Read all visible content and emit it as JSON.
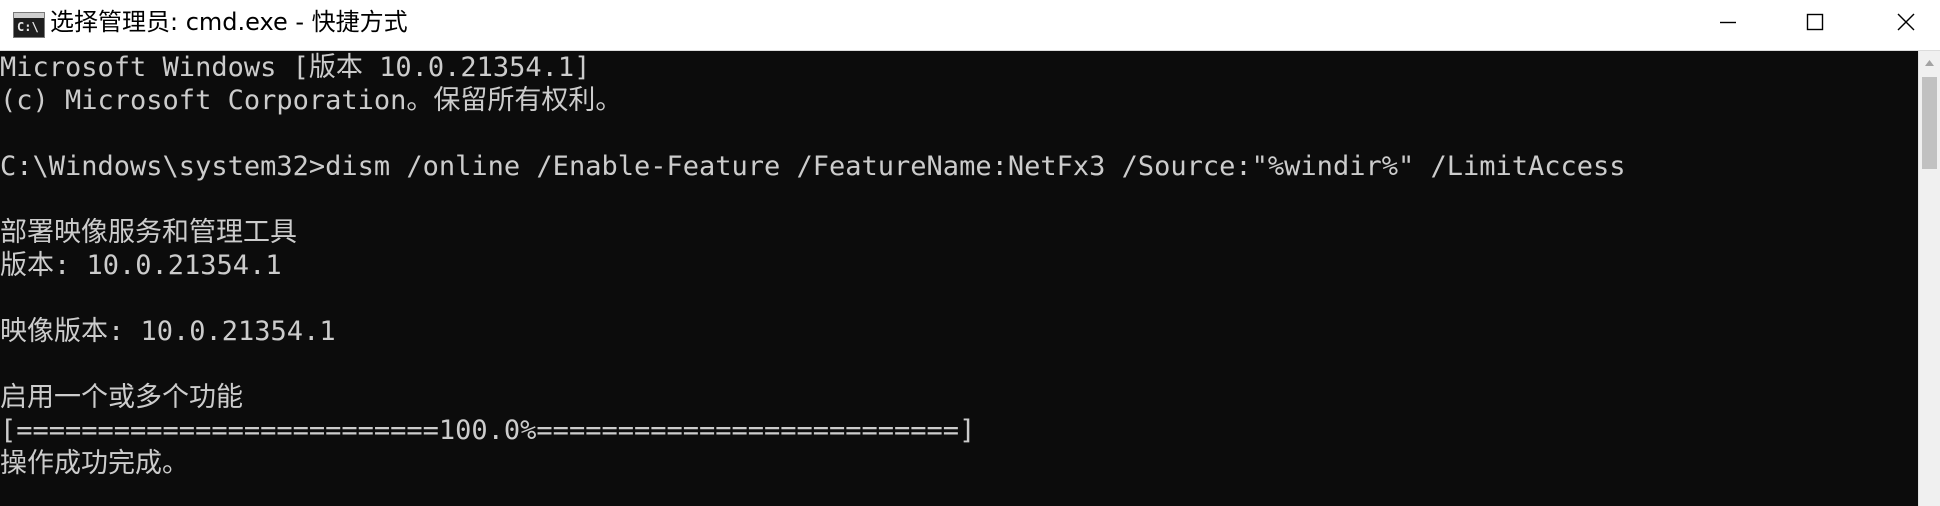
{
  "window": {
    "title": "选择管理员: cmd.exe - 快捷方式",
    "icon_name": "cmd-icon",
    "icon_glyph": "C:\\",
    "controls": {
      "minimize_icon": "minimize-icon",
      "maximize_icon": "maximize-icon",
      "close_icon": "close-icon"
    }
  },
  "console": {
    "text_color": "#cccccc",
    "background": "#0c0c0c",
    "lines": [
      "Microsoft Windows [版本 10.0.21354.1]",
      "(c) Microsoft Corporation。保留所有权利。",
      "",
      "C:\\Windows\\system32>dism /online /Enable-Feature /FeatureName:NetFx3 /Source:\"%windir%\" /LimitAccess",
      "",
      "部署映像服务和管理工具",
      "版本: 10.0.21354.1",
      "",
      "映像版本: 10.0.21354.1",
      "",
      "启用一个或多个功能",
      "[==========================100.0%==========================]",
      "操作成功完成。"
    ]
  },
  "progress": {
    "percent": 100.0
  }
}
